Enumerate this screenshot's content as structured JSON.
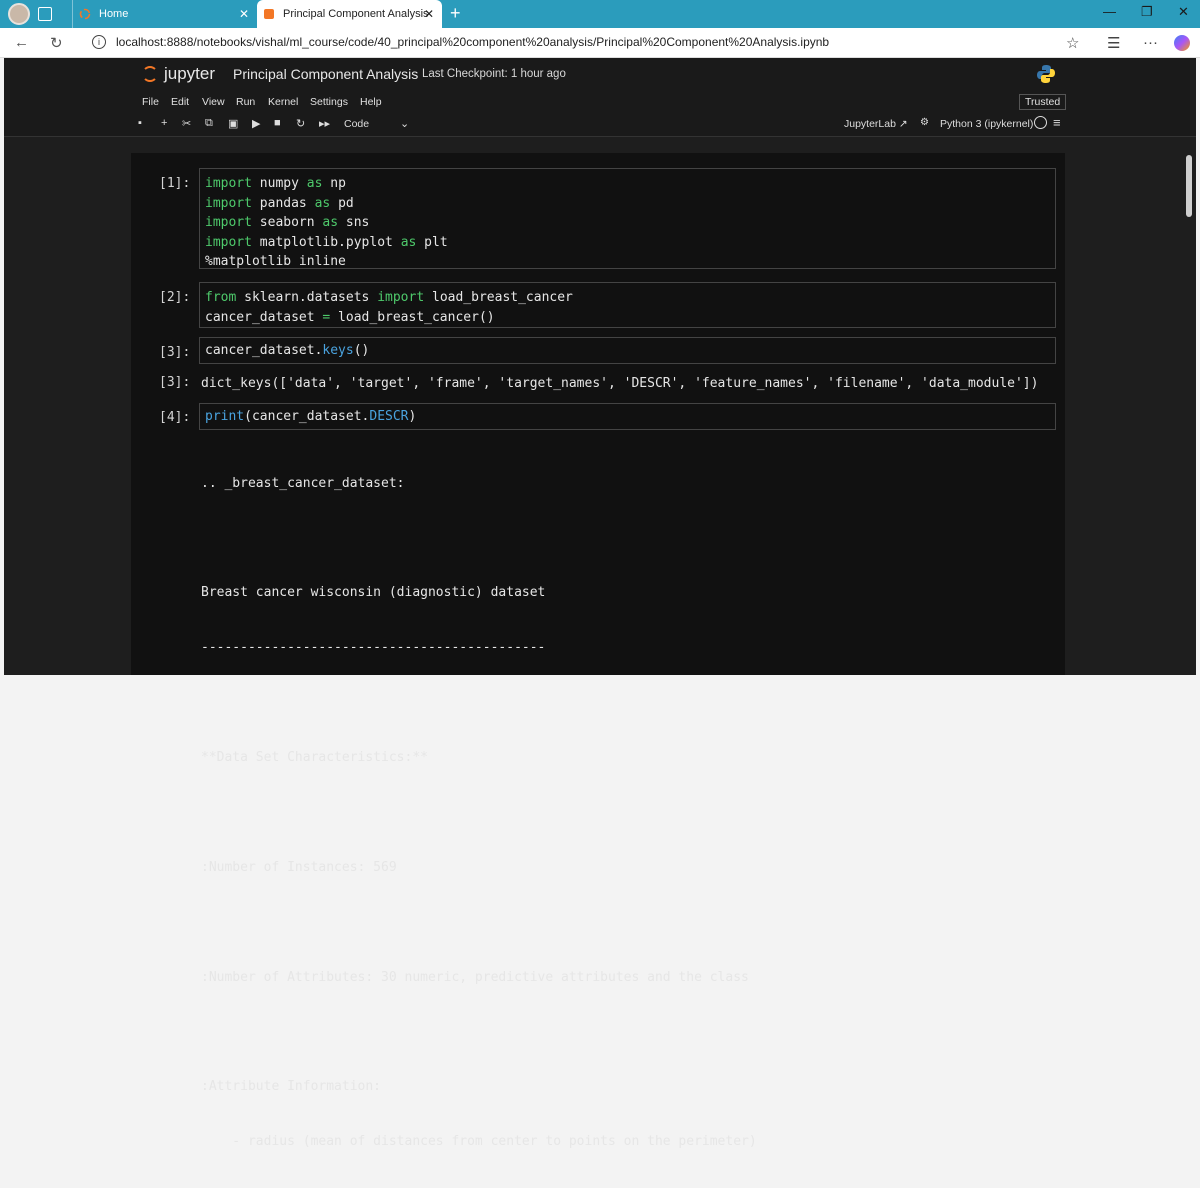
{
  "browser": {
    "tabs": [
      {
        "label": "Home"
      },
      {
        "label": "Principal Component Analysis"
      }
    ],
    "url": "localhost:8888/notebooks/vishal/ml_course/code/40_principal%20component%20analysis/Principal%20Component%20Analysis.ipynb"
  },
  "jupyter": {
    "brand": "jupyter",
    "title": "Principal Component Analysis",
    "checkpoint": "Last Checkpoint: 1 hour ago",
    "menu": [
      "File",
      "Edit",
      "View",
      "Run",
      "Kernel",
      "Settings",
      "Help"
    ],
    "trusted": "Trusted",
    "cell_type": "Code",
    "jupyterlab_link": "JupyterLab",
    "kernel": "Python 3 (ipykernel)"
  },
  "cells": [
    {
      "prompt": "[1]:",
      "lines": [
        [
          "kw",
          "import"
        ],
        [
          "t",
          " numpy "
        ],
        [
          "kw",
          "as"
        ],
        [
          "t",
          " np"
        ]
      ]
    },
    {
      "prompt": "[2]:"
    },
    {
      "prompt": "[3]:",
      "output_prompt": "[3]:",
      "output": "dict_keys(['data', 'target', 'frame', 'target_names', 'DESCR', 'feature_names', 'filename', 'data_module'])"
    },
    {
      "prompt": "[4]:"
    }
  ],
  "output4": [
    ".. _breast_cancer_dataset:",
    "",
    "Breast cancer wisconsin (diagnostic) dataset",
    "--------------------------------------------",
    "",
    "**Data Set Characteristics:**",
    "",
    ":Number of Instances: 569",
    "",
    ":Number of Attributes: 30 numeric, predictive attributes and the class",
    "",
    ":Attribute Information:",
    "    - radius (mean of distances from center to points on the perimeter)"
  ]
}
